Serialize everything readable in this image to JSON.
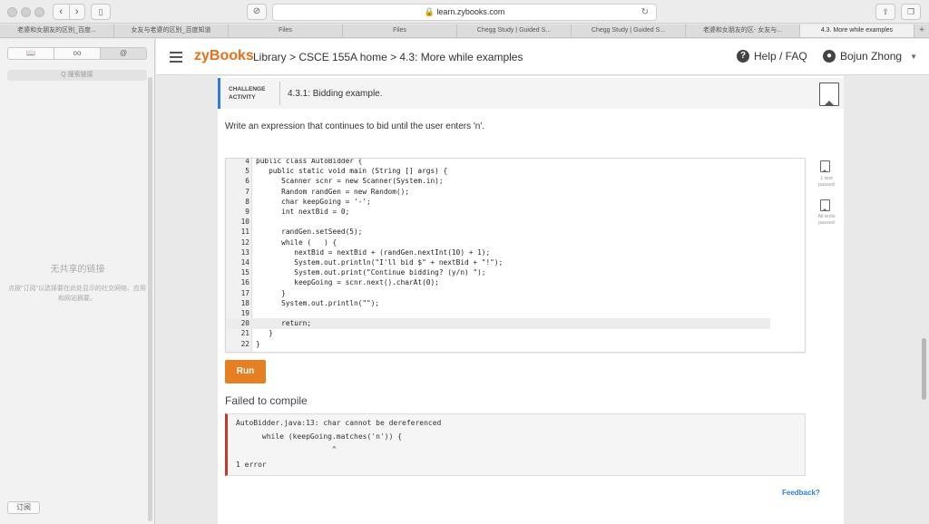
{
  "browser": {
    "url": "learn.zybooks.com",
    "tabs": [
      {
        "label": "老婆和女朋友的区别_百度...",
        "active": false
      },
      {
        "label": "女友与老婆的区别_百度知道",
        "active": false
      },
      {
        "label": "Files",
        "active": false
      },
      {
        "label": "Files",
        "active": false
      },
      {
        "label": "Chegg Study | Guided S...",
        "active": false
      },
      {
        "label": "Chegg Study | Guided S...",
        "active": false
      },
      {
        "label": "老婆和女朋友的区- 女友与...",
        "active": false
      },
      {
        "label": "4.3. More while examples",
        "active": true
      }
    ],
    "new_tab_label": "+"
  },
  "sidebar": {
    "segments": [
      "📖",
      "oo",
      "@"
    ],
    "search_placeholder": "Q 搜索链接",
    "empty_title": "无共享的链接",
    "empty_desc": "点按\"订阅\"以选择要在此处显示的社交网络、应用和网站摘要。",
    "subscribe_label": "订阅"
  },
  "header": {
    "logo": "zyBooks",
    "breadcrumb": "Library > CSCE 155A home > 4.3: More while examples",
    "help_label": "Help / FAQ",
    "user_name": "Bojun Zhong"
  },
  "challenge": {
    "label_line1": "CHALLENGE",
    "label_line2": "ACTIVITY",
    "title": "4.3.1: Bidding example.",
    "prompt": "Write an expression that continues to bid until the user enters 'n'.",
    "code_lines": [
      {
        "n": "4",
        "text": "public class AutoBidder {"
      },
      {
        "n": "5",
        "text": "   public static void main (String [] args) {"
      },
      {
        "n": "6",
        "text": "      Scanner scnr = new Scanner(System.in);"
      },
      {
        "n": "7",
        "text": "      Random randGen = new Random();"
      },
      {
        "n": "8",
        "text": "      char keepGoing = '-';"
      },
      {
        "n": "9",
        "text": "      int nextBid = 0;"
      },
      {
        "n": "10",
        "text": ""
      },
      {
        "n": "11",
        "text": "      randGen.setSeed(5);"
      },
      {
        "n": "12",
        "text": "      while (   ) {"
      },
      {
        "n": "13",
        "text": "         nextBid = nextBid + (randGen.nextInt(10) + 1);"
      },
      {
        "n": "14",
        "text": "         System.out.println(\"I'll bid $\" + nextBid + \"!\");"
      },
      {
        "n": "15",
        "text": "         System.out.print(\"Continue bidding? (y/n) \");"
      },
      {
        "n": "16",
        "text": "         keepGoing = scnr.next().charAt(0);"
      },
      {
        "n": "17",
        "text": "      }"
      },
      {
        "n": "18",
        "text": "      System.out.println(\"\");"
      },
      {
        "n": "19",
        "text": ""
      },
      {
        "n": "20",
        "text": "      return;"
      },
      {
        "n": "21",
        "text": "   }"
      },
      {
        "n": "22",
        "text": "}"
      }
    ],
    "test1_label": "1 test passed",
    "test2_label": "All tests passed",
    "run_label": "Run",
    "result_title": "Failed to compile",
    "error_lines": [
      "AutoBidder.java:13: char cannot be dereferenced",
      "      while (keepGoing.matches('n')) {",
      "                      ^",
      "1 error"
    ],
    "feedback_label": "Feedback?"
  },
  "colors": {
    "accent": "#e67e22",
    "link": "#2f7bd6",
    "error": "#c0392b"
  }
}
